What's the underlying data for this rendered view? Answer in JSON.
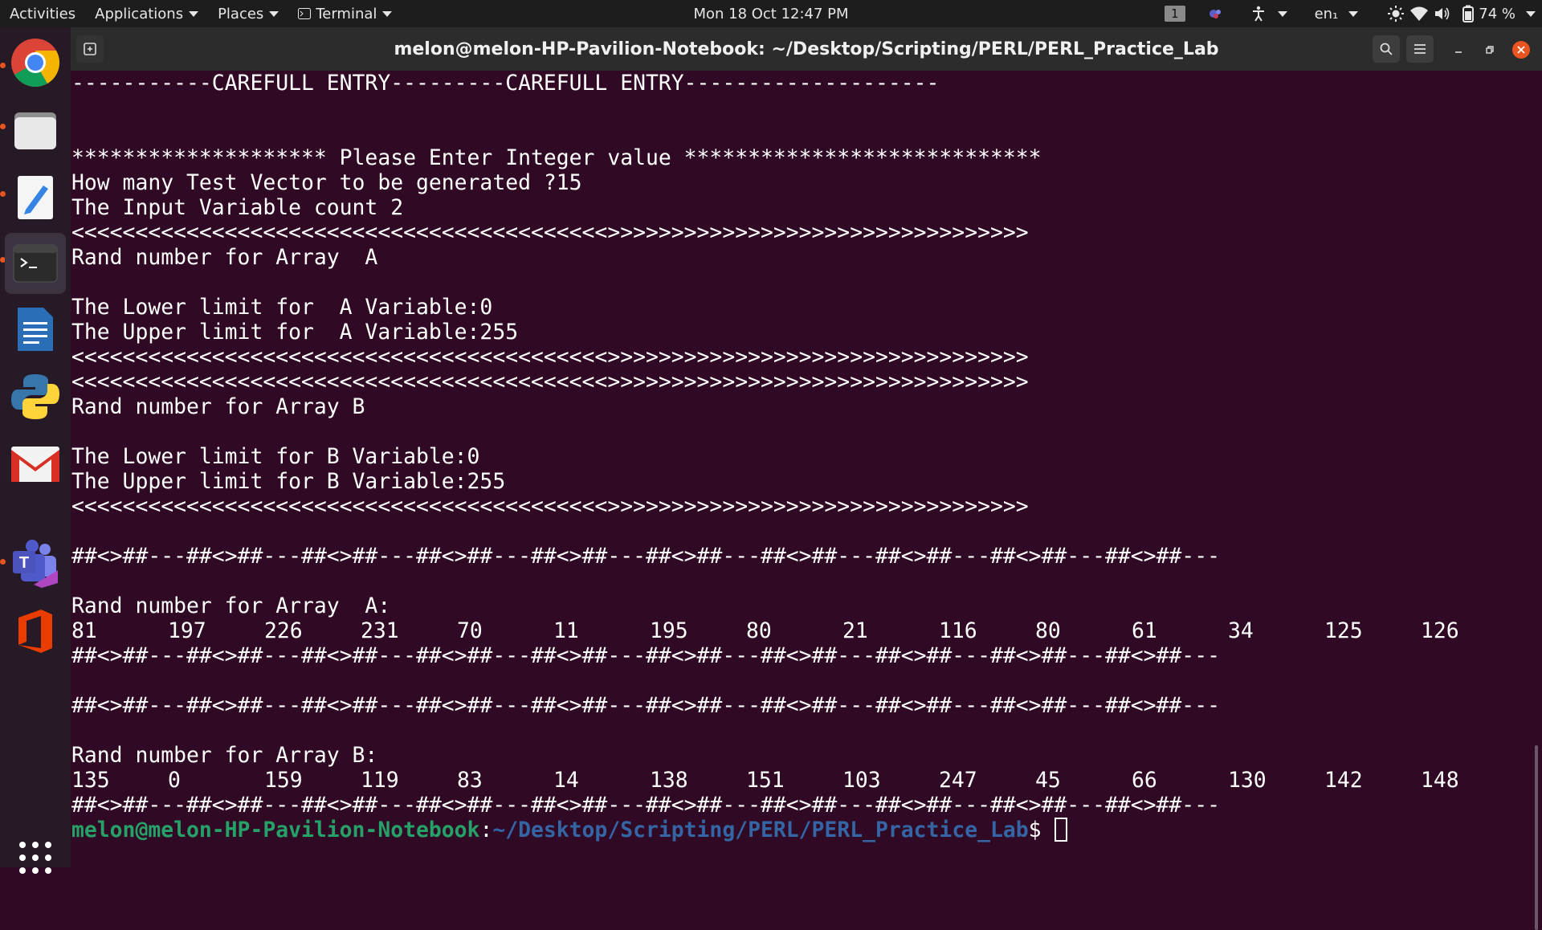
{
  "topbar": {
    "activities": "Activities",
    "applications": "Applications",
    "places": "Places",
    "terminal_menu": "Terminal",
    "clock": "Mon 18 Oct  12:47 PM",
    "workspace": "1",
    "language": "en₁",
    "battery": "74 %"
  },
  "window": {
    "title": "melon@melon-HP-Pavilion-Notebook: ~/Desktop/Scripting/PERL/PERL_Practice_Lab"
  },
  "terminal": {
    "lines": [
      "-----------CAREFULL ENTRY---------CAREFULL ENTRY--------------------",
      "",
      "",
      "******************** Please Enter Integer value ****************************",
      "How many Test Vector to be generated ?15",
      "The Input Variable count 2",
      "<<<<<<<<<<<<<<<<<<<<<<<<<<<<<<<<<<<<<<<<<<>>>>>>>>>>>>>>>>>>>>>>>>>>>>>>>>>",
      "Rand number for Array  A",
      "",
      "The Lower limit for  A Variable:0",
      "The Upper limit for  A Variable:255",
      "<<<<<<<<<<<<<<<<<<<<<<<<<<<<<<<<<<<<<<<<<<>>>>>>>>>>>>>>>>>>>>>>>>>>>>>>>>>",
      "<<<<<<<<<<<<<<<<<<<<<<<<<<<<<<<<<<<<<<<<<<>>>>>>>>>>>>>>>>>>>>>>>>>>>>>>>>>",
      "Rand number for Array B",
      "",
      "The Lower limit for B Variable:0",
      "The Upper limit for B Variable:255",
      "<<<<<<<<<<<<<<<<<<<<<<<<<<<<<<<<<<<<<<<<<<>>>>>>>>>>>>>>>>>>>>>>>>>>>>>>>>>",
      "",
      "##<>##---##<>##---##<>##---##<>##---##<>##---##<>##---##<>##---##<>##---##<>##---##<>##---",
      "",
      "Rand number for Array  A:"
    ],
    "array_a": [
      "81",
      "197",
      "226",
      "231",
      "70",
      "11",
      "195",
      "80",
      "21",
      "116",
      "80",
      "61",
      "34",
      "125",
      "126"
    ],
    "sep_a": "##<>##---##<>##---##<>##---##<>##---##<>##---##<>##---##<>##---##<>##---##<>##---##<>##---",
    "blank_1": "",
    "sep_b_top": "##<>##---##<>##---##<>##---##<>##---##<>##---##<>##---##<>##---##<>##---##<>##---##<>##---",
    "blank_2": "",
    "array_b_label": "Rand number for Array B:",
    "array_b": [
      "135",
      "0",
      "159",
      "119",
      "83",
      "14",
      "138",
      "151",
      "103",
      "247",
      "45",
      "66",
      "130",
      "142",
      "148"
    ],
    "sep_b": "##<>##---##<>##---##<>##---##<>##---##<>##---##<>##---##<>##---##<>##---##<>##---##<>##---",
    "prompt_user": "melon@melon-HP-Pavilion-Notebook",
    "prompt_colon": ":",
    "prompt_path": "~/Desktop/Scripting/PERL/PERL_Practice_Lab",
    "prompt_dollar": "$"
  },
  "colors": {
    "terminal_bg": "#300a24",
    "prompt_user": "#26a269",
    "prompt_path": "#3465a4",
    "accent_dot": "#e95420"
  },
  "dock_icons": [
    "chrome-icon",
    "files-icon",
    "text-editor-icon",
    "terminal-icon",
    "libreoffice-writer-icon",
    "python-icon",
    "gmail-icon",
    "teams-icon",
    "office-icon",
    "show-apps-icon"
  ]
}
